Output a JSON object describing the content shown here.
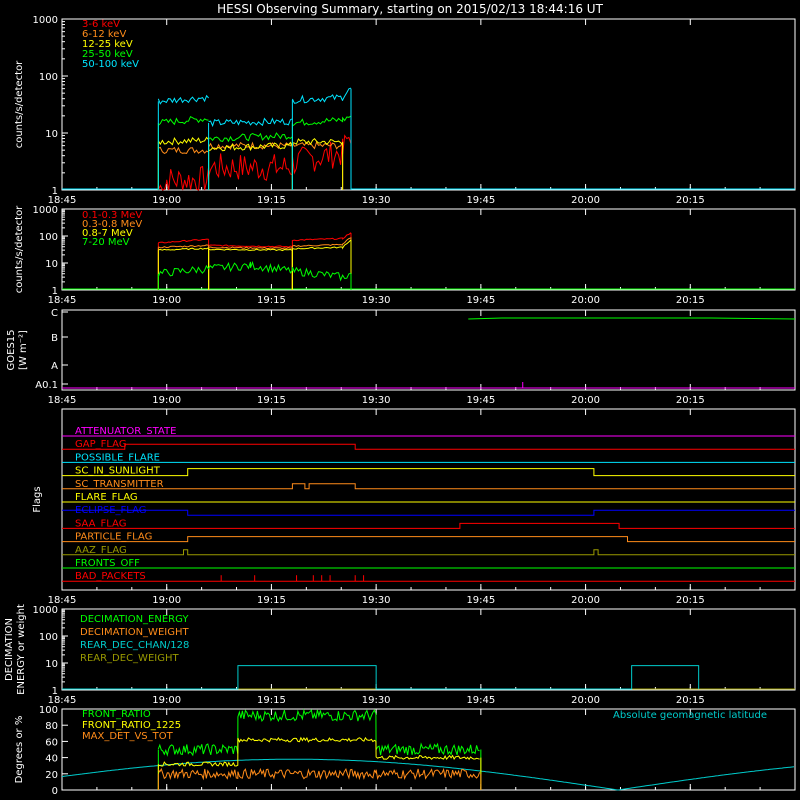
{
  "title": "HESSI Observing Summary, starting on 2015/02/13 18:44:16 UT",
  "colors": {
    "background": "#000000",
    "axis": "#ffffff",
    "red": "#ff0000",
    "orange": "#ff8c1a",
    "yellow": "#ffff00",
    "green": "#00ff00",
    "cyan": "#00e5ff",
    "magenta": "#ff00ff",
    "blue": "#0000ff",
    "olive": "#999900",
    "brown": "#c89630",
    "teal": "#00cccc"
  },
  "chart_data": [
    {
      "id": "panel1",
      "type": "line",
      "ylabel": "counts/s/detector",
      "ylog": true,
      "ylim": [
        1,
        1000
      ],
      "ytick_labels": [
        "1",
        "10",
        "100",
        "1000"
      ],
      "xlim": [
        "18:45",
        "20:30"
      ],
      "xtick_labels": [
        "18:45",
        "19:00",
        "19:15",
        "19:30",
        "19:45",
        "20:00",
        "20:15"
      ],
      "legend": "top-left",
      "series": [
        {
          "name": "3-6 keV",
          "color": "red",
          "segments": [
            [
              [
                18.98,
                1
              ],
              [
                19.0,
                1.5
              ],
              [
                19.1,
                1.5
              ]
            ],
            [
              [
                19.1,
                2.5
              ],
              [
                19.3,
                2.5
              ]
            ],
            [
              [
                19.3,
                3
              ],
              [
                19.42,
                4.5
              ],
              [
                19.44,
                10
              ]
            ]
          ]
        },
        {
          "name": "6-12 keV",
          "color": "orange",
          "segments": [
            [
              [
                18.98,
                5
              ],
              [
                19.1,
                5
              ]
            ],
            [
              [
                19.1,
                6
              ],
              [
                19.3,
                6
              ]
            ],
            [
              [
                19.3,
                6
              ],
              [
                19.42,
                6
              ]
            ]
          ]
        },
        {
          "name": "12-25 keV",
          "color": "yellow",
          "segments": [
            [
              [
                18.98,
                7
              ],
              [
                19.1,
                7.5
              ]
            ],
            [
              [
                19.1,
                5.5
              ],
              [
                19.3,
                6
              ]
            ],
            [
              [
                19.3,
                7
              ],
              [
                19.42,
                7
              ]
            ]
          ]
        },
        {
          "name": "25-50 keV",
          "color": "green",
          "segments": [
            [
              [
                18.98,
                15
              ],
              [
                19.1,
                18
              ]
            ],
            [
              [
                19.1,
                8
              ],
              [
                19.3,
                9
              ]
            ],
            [
              [
                19.3,
                15
              ],
              [
                19.42,
                17
              ],
              [
                19.44,
                20
              ]
            ]
          ]
        },
        {
          "name": "50-100 keV",
          "color": "cyan",
          "segments": [
            [
              [
                18.98,
                36
              ],
              [
                19.1,
                42
              ]
            ],
            [
              [
                19.1,
                15
              ],
              [
                19.3,
                16
              ]
            ],
            [
              [
                19.3,
                38
              ],
              [
                19.42,
                42
              ],
              [
                19.44,
                60
              ]
            ]
          ]
        }
      ]
    },
    {
      "id": "panel2",
      "type": "line",
      "ylabel": "counts/s/detector",
      "ylog": true,
      "ylim": [
        1,
        1000
      ],
      "ytick_labels": [
        "1",
        "10",
        "100",
        "1000"
      ],
      "xlim": [
        "18:45",
        "20:30"
      ],
      "xtick_labels": [
        "18:45",
        "19:00",
        "19:15",
        "19:30",
        "19:45",
        "20:00",
        "20:15"
      ],
      "legend": "top-left",
      "series": [
        {
          "name": "0.1-0.3 MeV",
          "color": "red",
          "segments": [
            [
              [
                18.98,
                55
              ],
              [
                19.1,
                75
              ]
            ],
            [
              [
                19.1,
                45
              ],
              [
                19.3,
                40
              ]
            ],
            [
              [
                19.3,
                70
              ],
              [
                19.42,
                80
              ],
              [
                19.44,
                130
              ]
            ]
          ]
        },
        {
          "name": "0.3-0.8 MeV",
          "color": "orange",
          "segments": [
            [
              [
                18.98,
                38
              ],
              [
                19.1,
                45
              ]
            ],
            [
              [
                19.1,
                38
              ],
              [
                19.3,
                35
              ]
            ],
            [
              [
                19.3,
                42
              ],
              [
                19.42,
                48
              ],
              [
                19.44,
                90
              ]
            ]
          ]
        },
        {
          "name": "0.8-7 MeV",
          "color": "yellow",
          "segments": [
            [
              [
                18.98,
                30
              ],
              [
                19.1,
                35
              ]
            ],
            [
              [
                19.1,
                32
              ],
              [
                19.3,
                30
              ]
            ],
            [
              [
                19.3,
                34
              ],
              [
                19.42,
                38
              ],
              [
                19.44,
                70
              ]
            ]
          ]
        },
        {
          "name": "7-20 MeV",
          "color": "green",
          "segments": [
            [
              [
                18.98,
                4
              ],
              [
                19.2,
                8
              ],
              [
                19.3,
                5
              ],
              [
                19.42,
                3
              ],
              [
                19.44,
                4
              ]
            ]
          ]
        }
      ]
    },
    {
      "id": "panel3",
      "type": "line",
      "ylabel": "GOES15",
      "ylabel2": "[W m⁻²]",
      "ytick_labels": [
        "A0.1",
        "A",
        "B",
        "C"
      ],
      "xlim": [
        "18:45",
        "20:30"
      ],
      "xtick_labels": [
        "18:45",
        "19:00",
        "19:15",
        "19:30",
        "19:45",
        "20:00",
        "20:15"
      ],
      "series": []
    },
    {
      "id": "flags",
      "type": "line",
      "ylabel": "Flags",
      "xlim": [
        "18:45",
        "20:30"
      ],
      "xtick_labels": [
        "18:45",
        "19:00",
        "19:15",
        "19:30",
        "19:45",
        "20:00",
        "20:15"
      ],
      "flags": [
        {
          "name": "ATTENUATOR_STATE",
          "color": "magenta"
        },
        {
          "name": "GAP_FLAG",
          "color": "red"
        },
        {
          "name": "POSSIBLE_FLARE",
          "color": "cyan"
        },
        {
          "name": "SC_IN_SUNLIGHT",
          "color": "yellow"
        },
        {
          "name": "SC_TRANSMITTER",
          "color": "orange"
        },
        {
          "name": "FLARE_FLAG",
          "color": "yellow"
        },
        {
          "name": "ECLIPSE_FLAG",
          "color": "blue"
        },
        {
          "name": "SAA_FLAG",
          "color": "red"
        },
        {
          "name": "PARTICLE_FLAG",
          "color": "orange"
        },
        {
          "name": "AAZ_FLAG",
          "color": "olive"
        },
        {
          "name": "FRONTS_OFF",
          "color": "green"
        },
        {
          "name": "BAD_PACKETS",
          "color": "red"
        }
      ]
    },
    {
      "id": "decimation",
      "type": "line",
      "ylabel": "DECIMATION",
      "ylabel2": "ENERGY or weight",
      "ylog": true,
      "ylim": [
        1,
        1000
      ],
      "ytick_labels": [
        "1",
        "10",
        "100",
        "1000"
      ],
      "xlim": [
        "18:45",
        "20:30"
      ],
      "xtick_labels": [
        "18:45",
        "19:00",
        "19:15",
        "19:30",
        "19:45",
        "20:00",
        "20:15"
      ],
      "legend": "top-left",
      "series": [
        {
          "name": "DECIMATION_ENERGY",
          "color": "green"
        },
        {
          "name": "DECIMATION_WEIGHT",
          "color": "orange"
        },
        {
          "name": "REAR_DEC_CHAN/128",
          "color": "teal"
        },
        {
          "name": "REAR_DEC_WEIGHT",
          "color": "olive"
        }
      ]
    },
    {
      "id": "ratio",
      "type": "line",
      "ylabel": "Degrees or %",
      "ylim": [
        0,
        100
      ],
      "ytick_labels": [
        "0",
        "20",
        "40",
        "60",
        "80",
        "100"
      ],
      "xlim": [
        "18:45",
        "20:30"
      ],
      "legend": "top-left",
      "annotation": "Absolute geomagnetic latitude",
      "series": [
        {
          "name": "FRONT_RATIO",
          "color": "green"
        },
        {
          "name": "FRONT_RATIO_1225",
          "color": "yellow"
        },
        {
          "name": "MAX_DET_VS_TOT",
          "color": "orange"
        }
      ]
    }
  ]
}
